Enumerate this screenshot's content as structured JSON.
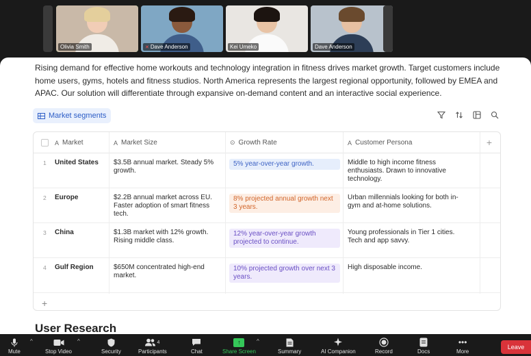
{
  "participants": [
    {
      "name": "Olivia Smith",
      "muted": false,
      "active": true,
      "colors": {
        "bg": "#c9b9a8",
        "skin": "#f1cdb6",
        "hair": "#e4cf9c",
        "shirt": "#f0ece6"
      }
    },
    {
      "name": "Dave Anderson",
      "muted": true,
      "active": false,
      "colors": {
        "bg": "#7fa7c4",
        "skin": "#8a5a3c",
        "hair": "#2a1a12",
        "shirt": "#3f5e8a"
      }
    },
    {
      "name": "Kei Umeko",
      "muted": false,
      "active": false,
      "colors": {
        "bg": "#e9e6e2",
        "skin": "#e8c3a5",
        "hair": "#1c1410",
        "shirt": "#fafafa"
      }
    },
    {
      "name": "Dave Anderson",
      "muted": false,
      "active": false,
      "colors": {
        "bg": "#b8c2cc",
        "skin": "#e7c0a2",
        "hair": "#6a4a2e",
        "shirt": "#2d3e57"
      }
    }
  ],
  "doc": {
    "intro": "Rising demand for effective home workouts and technology integration in fitness drives market growth. Target customers include home users, gyms, hotels and fitness studios. North America represents the largest regional opportunity, followed by EMEA and APAC. Our solution will differentiate through expansive on-demand content and an interactive social experience.",
    "view_label": "Market segments",
    "toolbar_icons": [
      "filter-icon",
      "sort-icon",
      "layout-icon",
      "search-icon"
    ],
    "table": {
      "headers": {
        "market": "Market",
        "size": "Market Size",
        "growth": "Growth Rate",
        "persona": "Customer Persona"
      },
      "rows": [
        {
          "num": "1",
          "market": "United States",
          "size": "$3.5B annual market. Steady 5% growth.",
          "growth": "5% year-over-year growth.",
          "growth_tone": "blue",
          "persona": "Middle to high income fitness enthusiasts. Drawn to innovative technology."
        },
        {
          "num": "2",
          "market": "Europe",
          "size": "$2.2B annual market across EU. Faster adoption of smart fitness tech.",
          "growth": "8% projected annual growth next 3 years.",
          "growth_tone": "orange",
          "persona": "Urban millennials looking for both in-gym and at-home solutions."
        },
        {
          "num": "3",
          "market": "China",
          "size": "$1.3B market with 12% growth. Rising middle class.",
          "growth": "12% year-over-year growth projected to continue.",
          "growth_tone": "purple",
          "persona": "Young professionals in Tier 1 cities. Tech and app savvy."
        },
        {
          "num": "4",
          "market": "Gulf Region",
          "size": "$650M concentrated high-end market.",
          "growth": "10% projected growth over next 3 years.",
          "growth_tone": "purple",
          "persona": "High disposable income."
        }
      ],
      "add_row": "+",
      "add_column": "+"
    },
    "section_title": "User Research"
  },
  "controls": {
    "mute": "Mute",
    "stop_video": "Stop Video",
    "security": "Security",
    "participants": "Participants",
    "participant_count": "4",
    "chat": "Chat",
    "share_screen": "Share Screen",
    "summary": "Summary",
    "ai_companion": "AI Companion",
    "record": "Record",
    "docs": "Docs",
    "more": "More",
    "leave": "Leave"
  }
}
